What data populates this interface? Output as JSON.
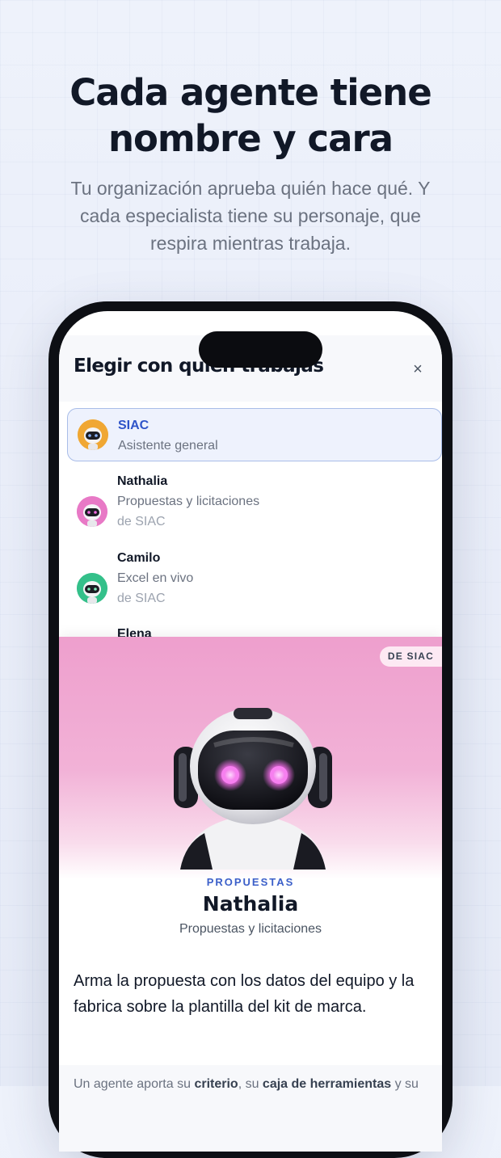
{
  "hero": {
    "headline_line1": "Cada agente tiene",
    "headline_line2": "nombre y cara",
    "subtitle_line1": "Tu organización aprueba quién hace qué. Y",
    "subtitle_line2": "cada especialista tiene su personaje, que",
    "subtitle_line3": "respira mientras trabaja."
  },
  "sheet": {
    "title": "Elegir con quién trabajas",
    "close_label": "×"
  },
  "agents": [
    {
      "name": "SIAC",
      "role": "Asistente general",
      "from": "",
      "color": "#f0a733",
      "selected": true
    },
    {
      "name": "Nathalia",
      "role": "Propuestas y licitaciones",
      "from": "de SIAC",
      "color": "#e879c6",
      "selected": false
    },
    {
      "name": "Camilo",
      "role": "Excel en vivo",
      "from": "de SIAC",
      "color": "#34c08a",
      "selected": false
    },
    {
      "name": "Elena",
      "role": "",
      "from": "",
      "color": "",
      "selected": false
    }
  ],
  "detail": {
    "badge": "DE SIAC",
    "category": "PROPUESTAS",
    "name": "Nathalia",
    "role": "Propuestas y licitaciones",
    "desc_line1": "Arma la propuesta con los datos del equipo y la",
    "desc_line2": "fabrica sobre la plantilla del kit de marca.",
    "footer_pre": "Un agente aporta su ",
    "footer_b1": "criterio",
    "footer_mid": ", su ",
    "footer_b2": "caja de herramientas",
    "footer_post": " y su",
    "accent_color": "#3b5fc9",
    "hero_color": "#ee9fcd"
  }
}
